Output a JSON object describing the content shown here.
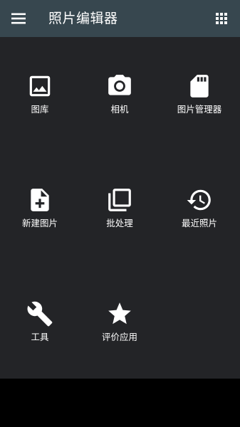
{
  "app": {
    "title": "照片编辑器"
  },
  "toolbar": {
    "menu_icon": "hamburger-menu-icon",
    "apps_icon": "grid-apps-icon",
    "background": "#37474f"
  },
  "main": {
    "background": "#232427",
    "tiles": [
      {
        "label": "图库",
        "icon": "image-icon"
      },
      {
        "label": "相机",
        "icon": "camera-icon"
      },
      {
        "label": "图片管理器",
        "icon": "sd-card-icon"
      },
      {
        "label": "新建图片",
        "icon": "new-file-icon"
      },
      {
        "label": "批处理",
        "icon": "batch-layers-icon"
      },
      {
        "label": "最近照片",
        "icon": "history-icon"
      },
      {
        "label": "工具",
        "icon": "wrench-icon"
      },
      {
        "label": "评价应用",
        "icon": "star-icon"
      }
    ]
  }
}
